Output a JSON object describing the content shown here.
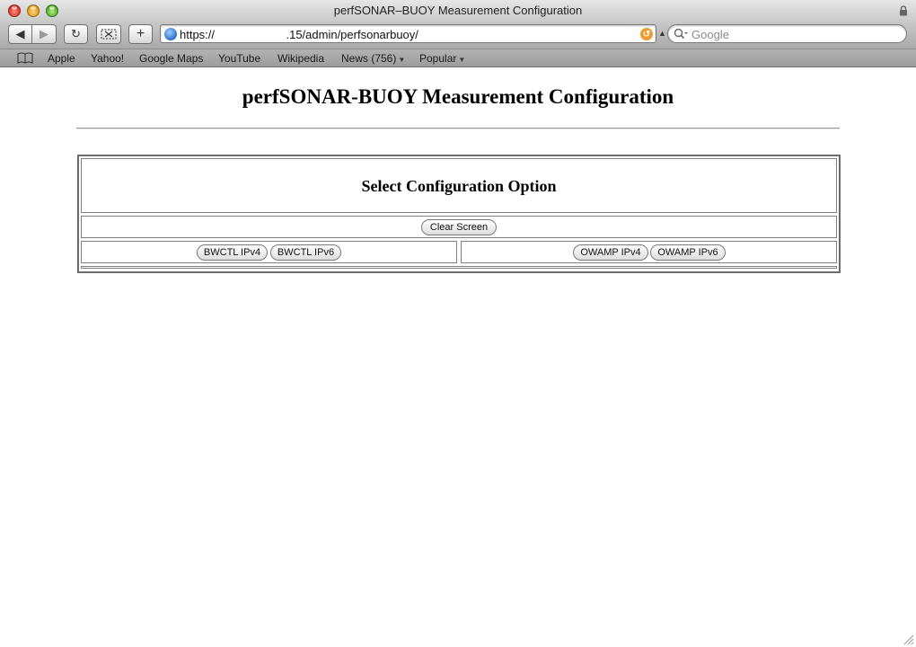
{
  "window": {
    "title": "perfSONAR–BUOY Measurement Configuration"
  },
  "toolbar": {
    "back_icon": "back-arrow-icon",
    "forward_icon": "forward-arrow-icon",
    "reload_icon": "reload-icon",
    "snip_icon": "snip-icon",
    "add_icon": "add-bookmark-icon",
    "url": "https://                      .15/admin/perfsonarbuoy/",
    "search_placeholder": "Google"
  },
  "bookmarks": {
    "items": [
      {
        "label": "Apple"
      },
      {
        "label": "Yahoo!"
      },
      {
        "label": "Google Maps"
      },
      {
        "label": "YouTube"
      },
      {
        "label": "Wikipedia"
      },
      {
        "label": "News (756)"
      },
      {
        "label": "Popular"
      }
    ]
  },
  "page": {
    "heading": "perfSONAR-BUOY Measurement Configuration",
    "config_heading": "Select Configuration Option",
    "buttons": {
      "clear": "Clear Screen",
      "bwctl_ipv4": "BWCTL IPv4",
      "bwctl_ipv6": "BWCTL IPv6",
      "owamp_ipv4": "OWAMP IPv4",
      "owamp_ipv6": "OWAMP IPv6"
    }
  },
  "colors": {
    "traffic_close": "#d8312a",
    "traffic_minimize": "#e09a1a",
    "traffic_zoom": "#4ea82a",
    "rss": "#f29a2e"
  }
}
